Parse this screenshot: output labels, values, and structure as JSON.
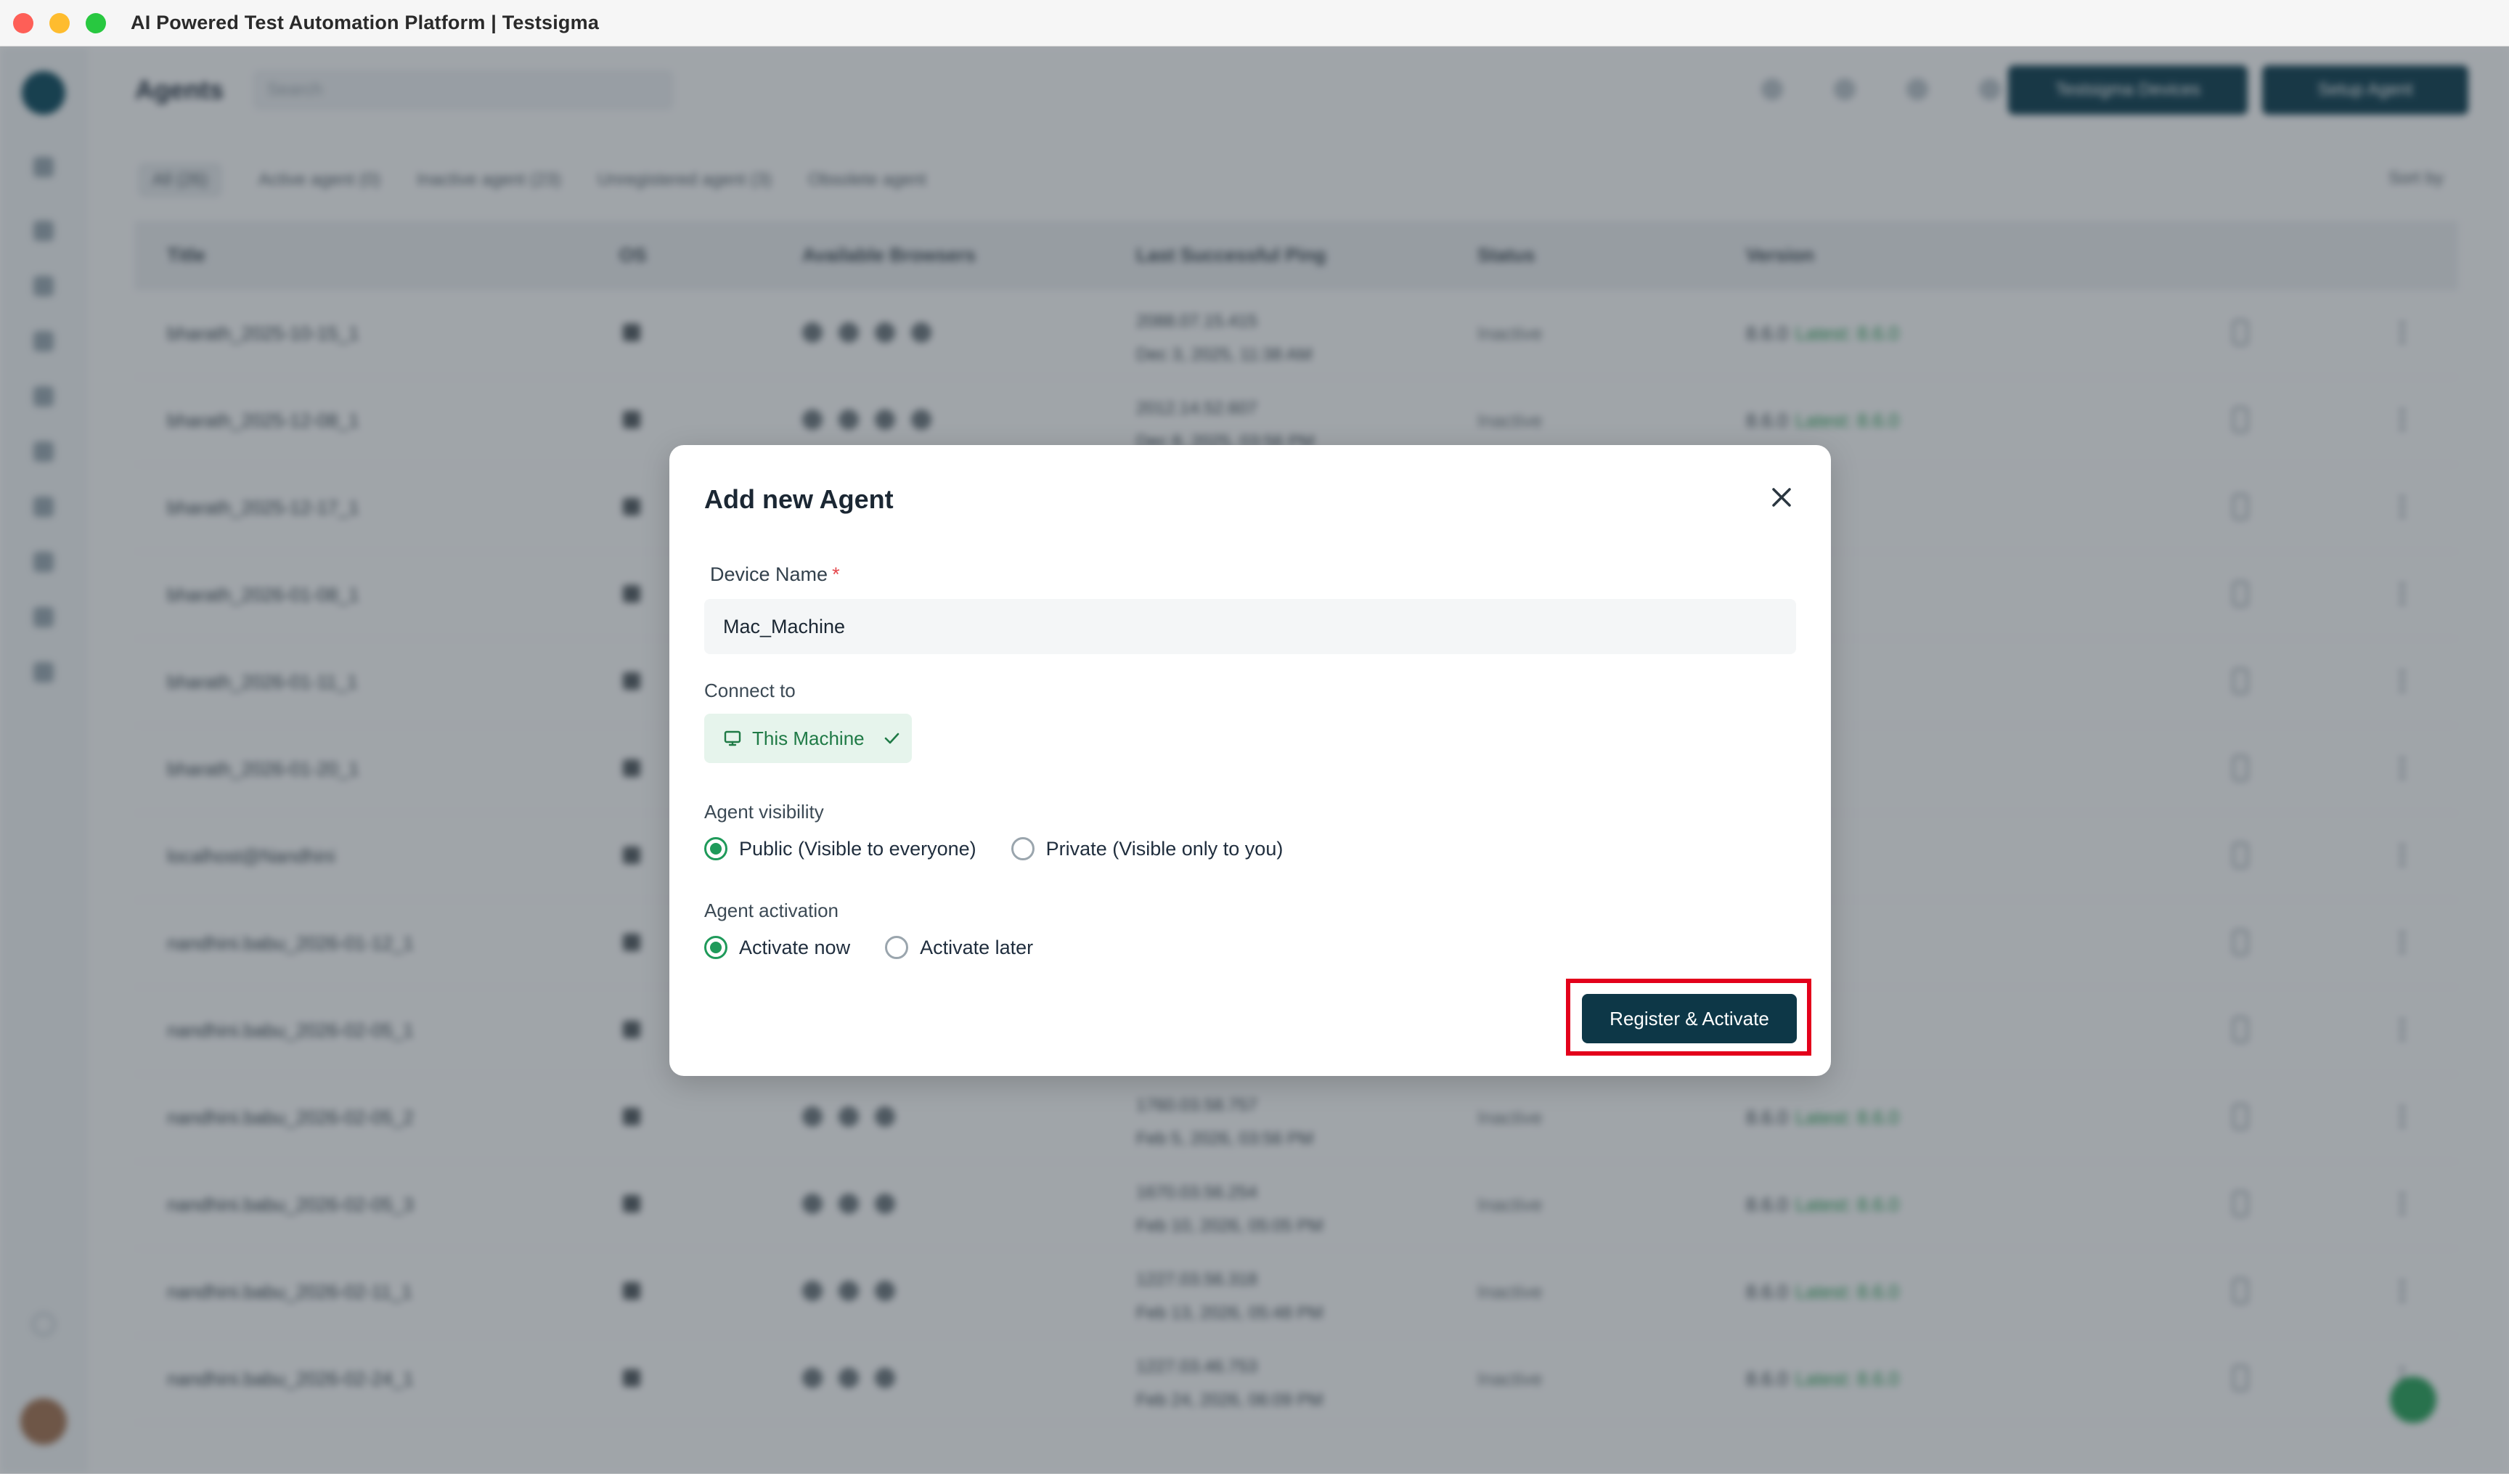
{
  "window": {
    "title": "AI Powered Test Automation Platform | Testsigma"
  },
  "background": {
    "page_title": "Agents",
    "search_placeholder": "Search",
    "buttons": [
      "Testsigma Devices",
      "Setup Agent"
    ],
    "filters": [
      "All (26)",
      "Active agent (0)",
      "Inactive agent (23)",
      "Unregistered agent (3)",
      "Obsolete agent"
    ],
    "sort_label": "Sort by",
    "columns": [
      "Title",
      "OS",
      "Available Browsers",
      "Last Successful Ping",
      "Status",
      "Version"
    ],
    "rows": [
      {
        "title": "bharath_2025-10-15_1",
        "browsers": 4,
        "ping1": "2088.07.15.415",
        "ping2": "Dec 3, 2025, 11:38 AM",
        "status": "Inactive",
        "version": "8.6.0",
        "latest": "Latest: 8.6.0"
      },
      {
        "title": "bharath_2025-12-08_1",
        "browsers": 4,
        "ping1": "2012.14.52.607",
        "ping2": "Dec 8, 2025, 03:56 PM",
        "status": "Inactive",
        "version": "8.6.0",
        "latest": "Latest: 8.6.0"
      },
      {
        "title": "bharath_2025-12-17_1",
        "browsers": 0,
        "ping1": "",
        "ping2": "",
        "status": "",
        "version": "",
        "latest": ""
      },
      {
        "title": "bharath_2026-01-08_1",
        "browsers": 0,
        "ping1": "",
        "ping2": "",
        "status": "",
        "version": "",
        "latest": ""
      },
      {
        "title": "bharath_2026-01-11_1",
        "browsers": 0,
        "ping1": "",
        "ping2": "",
        "status": "",
        "version": "",
        "latest": ""
      },
      {
        "title": "bharath_2026-01-20_1",
        "browsers": 0,
        "ping1": "",
        "ping2": "",
        "status": "",
        "version": "",
        "latest": ""
      },
      {
        "title": "localhost@Nandhini",
        "browsers": 0,
        "ping1": "",
        "ping2": "",
        "status": "",
        "version": "",
        "latest": ""
      },
      {
        "title": "nandhini.babu_2026-01-12_1",
        "browsers": 0,
        "ping1": "",
        "ping2": "",
        "status": "",
        "version": "",
        "latest": ""
      },
      {
        "title": "nandhini.babu_2026-02-05_1",
        "browsers": 0,
        "ping1": "",
        "ping2": "",
        "status": "",
        "version": "",
        "latest": ""
      },
      {
        "title": "nandhini.babu_2026-02-05_2",
        "browsers": 3,
        "ping1": "1760.03.58.757",
        "ping2": "Feb 5, 2026, 03:56 PM",
        "status": "Inactive",
        "version": "8.6.0",
        "latest": "Latest: 8.6.0"
      },
      {
        "title": "nandhini.babu_2026-02-05_3",
        "browsers": 3,
        "ping1": "1670.03.56.254",
        "ping2": "Feb 10, 2026, 05:05 PM",
        "status": "Inactive",
        "version": "8.6.0",
        "latest": "Latest: 8.6.0"
      },
      {
        "title": "nandhini.babu_2026-02-11_1",
        "browsers": 3,
        "ping1": "1227.03.56.318",
        "ping2": "Feb 13, 2026, 05:48 PM",
        "status": "Inactive",
        "version": "8.6.0",
        "latest": "Latest: 8.6.0"
      },
      {
        "title": "nandhini.babu_2026-02-24_1",
        "browsers": 3,
        "ping1": "1227.03.46.753",
        "ping2": "Feb 24, 2026, 06:09 PM",
        "status": "Inactive",
        "version": "8.6.0",
        "latest": "Latest: 8.6.0"
      }
    ]
  },
  "modal": {
    "title": "Add new Agent",
    "device_name_label": "Device Name",
    "required_mark": "*",
    "device_name_value": "Mac_Machine",
    "connect_label": "Connect to",
    "connect_option": "This Machine",
    "visibility_label": "Agent visibility",
    "visibility_options": [
      {
        "label": "Public (Visible to everyone)",
        "selected": true
      },
      {
        "label": "Private (Visible only to you)",
        "selected": false
      }
    ],
    "activation_label": "Agent activation",
    "activation_options": [
      {
        "label": "Activate now",
        "selected": true
      },
      {
        "label": "Activate later",
        "selected": false
      }
    ],
    "submit_label": "Register & Activate"
  },
  "colors": {
    "primary": "#0d3747",
    "accent_green": "#1f9a5a",
    "chip_bg": "#e6f4ec",
    "highlight_red": "#e3001b",
    "required_red": "#e5484d"
  }
}
